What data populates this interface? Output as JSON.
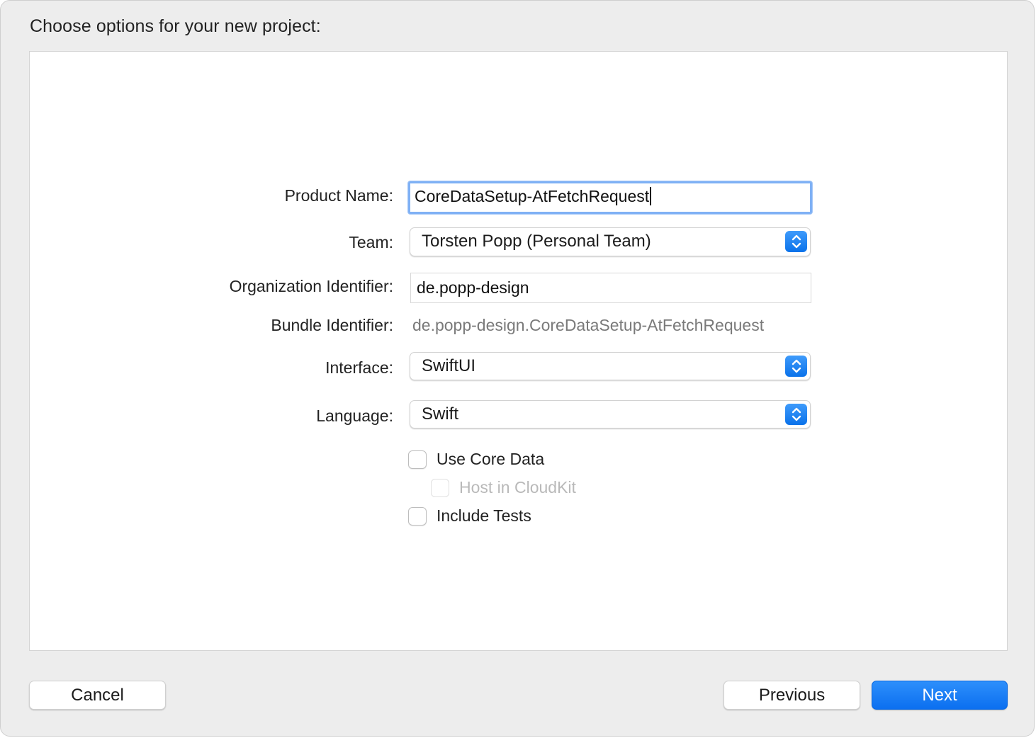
{
  "dialog": {
    "heading": "Choose options for your new project:"
  },
  "form": {
    "product_name": {
      "label": "Product Name:",
      "value": "CoreDataSetup-AtFetchRequest"
    },
    "team": {
      "label": "Team:",
      "value": "Torsten Popp (Personal Team)"
    },
    "organization_identifier": {
      "label": "Organization Identifier:",
      "value": "de.popp-design"
    },
    "bundle_identifier": {
      "label": "Bundle Identifier:",
      "value": "de.popp-design.CoreDataSetup-AtFetchRequest"
    },
    "interface": {
      "label": "Interface:",
      "value": "SwiftUI"
    },
    "language": {
      "label": "Language:",
      "value": "Swift"
    },
    "checkboxes": {
      "use_core_data": {
        "label": "Use Core Data",
        "checked": false,
        "enabled": true
      },
      "host_in_cloudkit": {
        "label": "Host in CloudKit",
        "checked": false,
        "enabled": false
      },
      "include_tests": {
        "label": "Include Tests",
        "checked": false,
        "enabled": true
      }
    }
  },
  "buttons": {
    "cancel": "Cancel",
    "previous": "Previous",
    "next": "Next"
  },
  "icons": {
    "popup_stepper": "chevron-up-down-icon"
  },
  "colors": {
    "accent": "#0a72ea",
    "focus_ring": "#7fb1f5"
  }
}
